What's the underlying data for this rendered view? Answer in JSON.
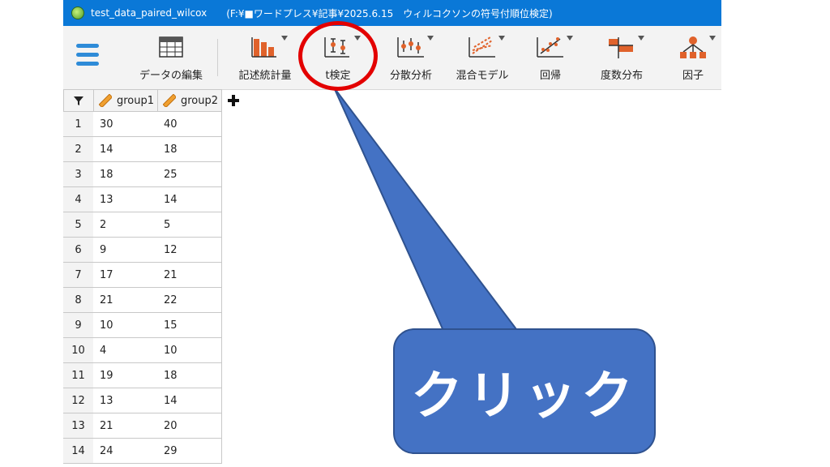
{
  "window": {
    "title_name": "test_data_paired_wilcox",
    "title_path": "(F:¥■ワードプレス¥記事¥2025.6.15　ウィルコクソンの符号付順位検定)"
  },
  "toolbar": {
    "items": [
      {
        "label": "データの編集",
        "icon": "spreadsheet-icon"
      },
      {
        "label": "記述統計量",
        "icon": "bar-chart-icon"
      },
      {
        "label": "t検定",
        "icon": "t-test-icon"
      },
      {
        "label": "分散分析",
        "icon": "anova-icon"
      },
      {
        "label": "混合モデル",
        "icon": "mixed-model-icon"
      },
      {
        "label": "回帰",
        "icon": "regression-icon"
      },
      {
        "label": "度数分布",
        "icon": "frequency-icon"
      },
      {
        "label": "因子",
        "icon": "factor-icon"
      }
    ],
    "accent": "#2e8bd8",
    "icon_color": "#e0622b"
  },
  "table": {
    "columns": [
      "group1",
      "group2"
    ],
    "rows": [
      {
        "index": "1",
        "group1": "30",
        "group2": "40"
      },
      {
        "index": "2",
        "group1": "14",
        "group2": "18"
      },
      {
        "index": "3",
        "group1": "18",
        "group2": "25"
      },
      {
        "index": "4",
        "group1": "13",
        "group2": "14"
      },
      {
        "index": "5",
        "group1": "2",
        "group2": "5"
      },
      {
        "index": "6",
        "group1": "9",
        "group2": "12"
      },
      {
        "index": "7",
        "group1": "17",
        "group2": "21"
      },
      {
        "index": "8",
        "group1": "21",
        "group2": "22"
      },
      {
        "index": "9",
        "group1": "10",
        "group2": "15"
      },
      {
        "index": "10",
        "group1": "4",
        "group2": "10"
      },
      {
        "index": "11",
        "group1": "19",
        "group2": "18"
      },
      {
        "index": "12",
        "group1": "13",
        "group2": "14"
      },
      {
        "index": "13",
        "group1": "21",
        "group2": "20"
      },
      {
        "index": "14",
        "group1": "24",
        "group2": "29"
      }
    ]
  },
  "annotation": {
    "callout_text": "クリック",
    "callout_color": "#4472c4",
    "circle_color": "#e30000"
  }
}
